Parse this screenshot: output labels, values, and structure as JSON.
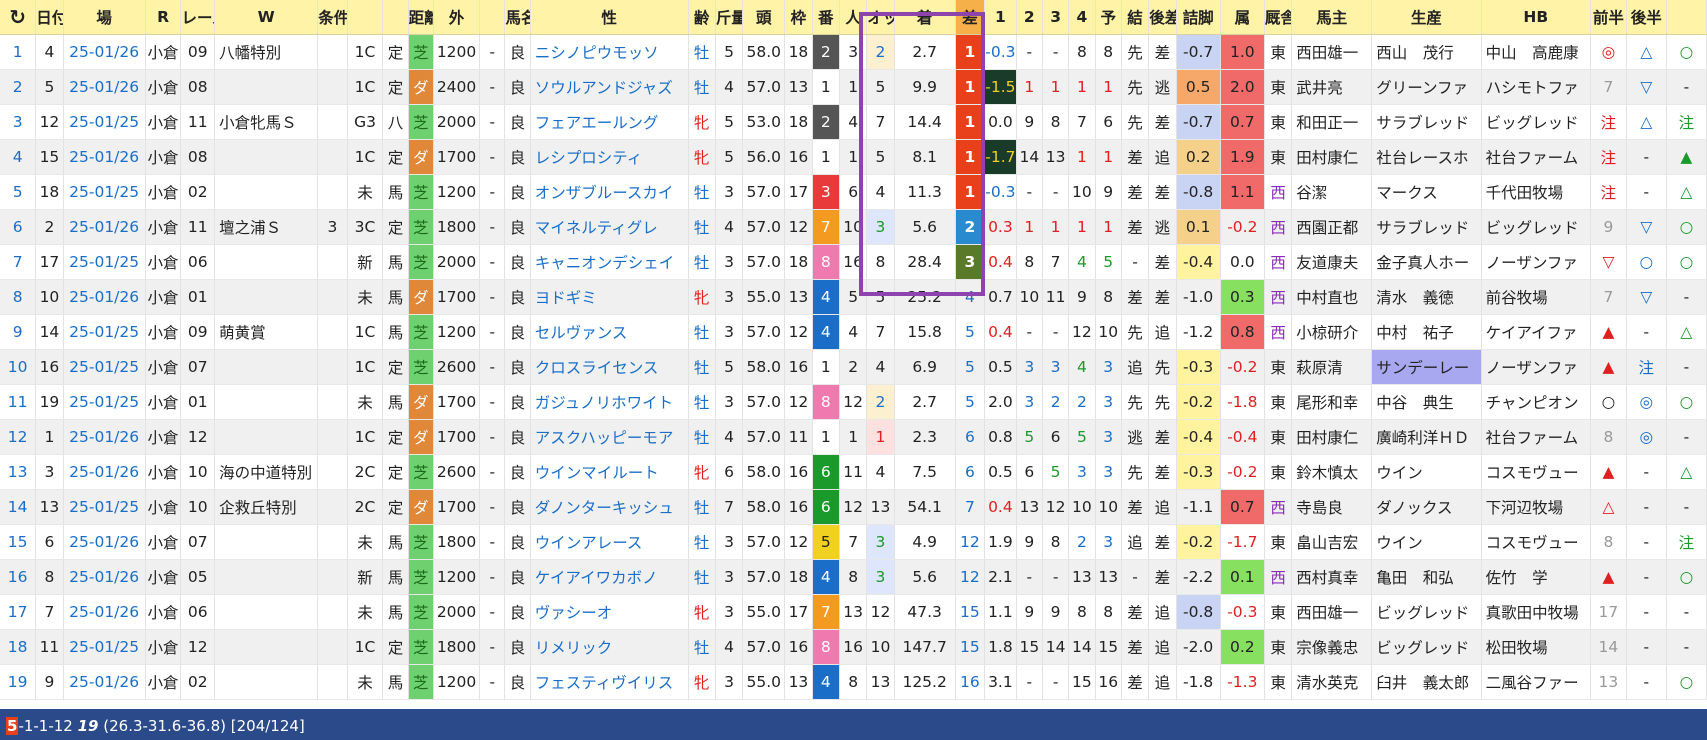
{
  "header": {
    "refresh_icon": "refresh-icon",
    "columns": [
      "",
      "日付",
      "場",
      "R",
      "レース名",
      "W",
      "条件",
      "",
      "",
      "距離",
      "外",
      "",
      "馬名",
      "性",
      "齢",
      "斤量",
      "頭",
      "枠",
      "番",
      "人",
      "オッズ",
      "着",
      "差",
      "1",
      "2",
      "3",
      "4",
      "予",
      "結",
      "後差",
      "詰脚",
      "属",
      "厩舎",
      "馬主",
      "生産",
      "HB",
      "前半",
      "後半"
    ]
  },
  "colors": {
    "waku": {
      "1": "#ffffff",
      "2": "#555555",
      "3": "#e83a3a",
      "4": "#1a6ec8",
      "5": "#f0d020",
      "6": "#1a9a2a",
      "7": "#f59a20",
      "8": "#f07ab0"
    },
    "turf": "#6fd06f",
    "dirt": "#e0883a",
    "finish1": "#e8401a",
    "finish2": "#2a8ad0",
    "finish3": "#5a7a2a",
    "highlight_box": "#8e44ad"
  },
  "rows": [
    {
      "no": "1",
      "x": "4",
      "date": "25-01/26",
      "place": "小倉",
      "r": "09",
      "race": "八幡特別",
      "w": "",
      "cls": "1C",
      "cond": "定",
      "surf": "芝",
      "dist": "1200",
      "out": "-",
      "track": "良",
      "horse": "ニシノピウモッソ",
      "sex": "牡",
      "age": "5",
      "wt": "58.0",
      "heads": "18",
      "waku": "2",
      "ban": "3",
      "pop": "2",
      "odds": "2.7",
      "fin": "1",
      "diff": "-0.3",
      "c1": "-",
      "c2": "-",
      "c3": "8",
      "c4": "8",
      "yo": "先",
      "res": "差",
      "kosa": "-0.7",
      "tsume": "1.0",
      "zoku": "東",
      "stable": "西田雄一",
      "owner": "西山　茂行",
      "breeder": "中山　高鹿康",
      "hb": "◎",
      "zen": "△",
      "kou": "○"
    },
    {
      "no": "2",
      "x": "5",
      "date": "25-01/26",
      "place": "小倉",
      "r": "08",
      "race": "",
      "w": "",
      "cls": "1C",
      "cond": "定",
      "surf": "ダ",
      "dist": "2400",
      "out": "-",
      "track": "良",
      "horse": "ソウルアンドジャズ",
      "sex": "牡",
      "age": "4",
      "wt": "57.0",
      "heads": "13",
      "waku": "1",
      "ban": "1",
      "pop": "5",
      "odds": "9.9",
      "fin": "1",
      "diff": "-1.5",
      "c1": "1",
      "c2": "1",
      "c3": "1",
      "c4": "1",
      "yo": "先",
      "res": "逃",
      "kosa": "0.5",
      "tsume": "2.0",
      "zoku": "東",
      "stable": "武井亮",
      "owner": "グリーンファ",
      "breeder": "ハシモトファ",
      "hb": "7",
      "zen": "▽",
      "kou": "-"
    },
    {
      "no": "3",
      "x": "12",
      "date": "25-01/25",
      "place": "小倉",
      "r": "11",
      "race": "小倉牝馬Ｓ",
      "w": "",
      "cls": "G3",
      "cond": "八",
      "surf": "芝",
      "dist": "2000",
      "out": "-",
      "track": "良",
      "horse": "フェアエールング",
      "sex": "牝",
      "age": "5",
      "wt": "53.0",
      "heads": "18",
      "waku": "2",
      "ban": "4",
      "pop": "7",
      "odds": "14.4",
      "fin": "1",
      "diff": "0.0",
      "c1": "9",
      "c2": "8",
      "c3": "7",
      "c4": "6",
      "yo": "先",
      "res": "差",
      "kosa": "-0.7",
      "tsume": "0.7",
      "zoku": "東",
      "stable": "和田正一",
      "owner": "サラブレッド",
      "breeder": "ビッグレッド",
      "hb": "注",
      "zen": "△",
      "kou": "注"
    },
    {
      "no": "4",
      "x": "15",
      "date": "25-01/26",
      "place": "小倉",
      "r": "08",
      "race": "",
      "w": "",
      "cls": "1C",
      "cond": "定",
      "surf": "ダ",
      "dist": "1700",
      "out": "-",
      "track": "良",
      "horse": "レシプロシティ",
      "sex": "牝",
      "age": "5",
      "wt": "56.0",
      "heads": "16",
      "waku": "1",
      "ban": "1",
      "pop": "5",
      "odds": "8.1",
      "fin": "1",
      "diff": "-1.7",
      "c1": "14",
      "c2": "13",
      "c3": "1",
      "c4": "1",
      "yo": "差",
      "res": "追",
      "kosa": "0.2",
      "tsume": "1.9",
      "zoku": "東",
      "stable": "田村康仁",
      "owner": "社台レースホ",
      "breeder": "社台ファーム",
      "hb": "注",
      "zen": "-",
      "kou": "▲"
    },
    {
      "no": "5",
      "x": "18",
      "date": "25-01/25",
      "place": "小倉",
      "r": "02",
      "race": "",
      "w": "",
      "cls": "未",
      "cond": "馬",
      "surf": "芝",
      "dist": "1200",
      "out": "-",
      "track": "良",
      "horse": "オンザブルースカイ",
      "sex": "牡",
      "age": "3",
      "wt": "57.0",
      "heads": "17",
      "waku": "3",
      "ban": "6",
      "pop": "4",
      "odds": "11.3",
      "fin": "1",
      "diff": "-0.3",
      "c1": "-",
      "c2": "-",
      "c3": "10",
      "c4": "9",
      "yo": "差",
      "res": "差",
      "kosa": "-0.8",
      "tsume": "1.1",
      "zoku": "西",
      "stable": "谷潔",
      "owner": "マークス",
      "breeder": "千代田牧場",
      "hb": "注",
      "zen": "-",
      "kou": "△"
    },
    {
      "no": "6",
      "x": "2",
      "date": "25-01/26",
      "place": "小倉",
      "r": "11",
      "race": "壇之浦Ｓ",
      "w": "3",
      "cls": "3C",
      "cond": "定",
      "surf": "芝",
      "dist": "1800",
      "out": "-",
      "track": "良",
      "horse": "マイネルティグレ",
      "sex": "牡",
      "age": "4",
      "wt": "57.0",
      "heads": "12",
      "waku": "7",
      "ban": "10",
      "pop": "3",
      "odds": "5.6",
      "fin": "2",
      "diff": "0.3",
      "c1": "1",
      "c2": "1",
      "c3": "1",
      "c4": "1",
      "yo": "差",
      "res": "逃",
      "kosa": "0.1",
      "tsume": "-0.2",
      "zoku": "西",
      "stable": "西園正都",
      "owner": "サラブレッド",
      "breeder": "ビッグレッド",
      "hb": "9",
      "zen": "▽",
      "kou": "○"
    },
    {
      "no": "7",
      "x": "17",
      "date": "25-01/25",
      "place": "小倉",
      "r": "06",
      "race": "",
      "w": "",
      "cls": "新",
      "cond": "馬",
      "surf": "芝",
      "dist": "2000",
      "out": "-",
      "track": "良",
      "horse": "キャニオンデシェイ",
      "sex": "牡",
      "age": "3",
      "wt": "57.0",
      "heads": "18",
      "waku": "8",
      "ban": "16",
      "pop": "8",
      "odds": "28.4",
      "fin": "3",
      "diff": "0.4",
      "c1": "8",
      "c2": "7",
      "c3": "4",
      "c4": "5",
      "yo": "-",
      "res": "差",
      "kosa": "-0.4",
      "tsume": "0.0",
      "zoku": "西",
      "stable": "友道康夫",
      "owner": "金子真人ホー",
      "breeder": "ノーザンファ",
      "hb": "▽",
      "zen": "○",
      "kou": "○"
    },
    {
      "no": "8",
      "x": "10",
      "date": "25-01/26",
      "place": "小倉",
      "r": "01",
      "race": "",
      "w": "",
      "cls": "未",
      "cond": "馬",
      "surf": "ダ",
      "dist": "1700",
      "out": "-",
      "track": "良",
      "horse": "ヨドギミ",
      "sex": "牝",
      "age": "3",
      "wt": "55.0",
      "heads": "13",
      "waku": "4",
      "ban": "5",
      "pop": "5",
      "odds": "25.2",
      "fin": "4",
      "diff": "0.7",
      "c1": "10",
      "c2": "11",
      "c3": "9",
      "c4": "8",
      "yo": "差",
      "res": "差",
      "kosa": "-1.0",
      "tsume": "0.3",
      "zoku": "西",
      "stable": "中村直也",
      "owner": "清水　義徳",
      "breeder": "前谷牧場",
      "hb": "7",
      "zen": "▽",
      "kou": "-"
    },
    {
      "no": "9",
      "x": "14",
      "date": "25-01/25",
      "place": "小倉",
      "r": "09",
      "race": "萌黄賞",
      "w": "",
      "cls": "1C",
      "cond": "馬",
      "surf": "芝",
      "dist": "1200",
      "out": "-",
      "track": "良",
      "horse": "セルヴァンス",
      "sex": "牡",
      "age": "3",
      "wt": "57.0",
      "heads": "12",
      "waku": "4",
      "ban": "4",
      "pop": "7",
      "odds": "15.8",
      "fin": "5",
      "diff": "0.4",
      "c1": "-",
      "c2": "-",
      "c3": "12",
      "c4": "10",
      "yo": "先",
      "res": "追",
      "kosa": "-1.2",
      "tsume": "0.8",
      "zoku": "西",
      "stable": "小椋研介",
      "owner": "中村　祐子",
      "breeder": "ケイアイファ",
      "hb": "▲",
      "zen": "-",
      "kou": "△"
    },
    {
      "no": "10",
      "x": "16",
      "date": "25-01/25",
      "place": "小倉",
      "r": "07",
      "race": "",
      "w": "",
      "cls": "1C",
      "cond": "定",
      "surf": "芝",
      "dist": "2600",
      "out": "-",
      "track": "良",
      "horse": "クロスライセンス",
      "sex": "牡",
      "age": "5",
      "wt": "58.0",
      "heads": "16",
      "waku": "1",
      "ban": "2",
      "pop": "4",
      "odds": "6.9",
      "fin": "5",
      "diff": "0.5",
      "c1": "3",
      "c2": "3",
      "c3": "4",
      "c4": "3",
      "yo": "追",
      "res": "先",
      "kosa": "-0.3",
      "tsume": "-0.2",
      "zoku": "東",
      "stable": "萩原清",
      "owner": "サンデーレー",
      "breeder": "ノーザンファ",
      "hb": "▲",
      "zen": "注",
      "kou": "-"
    },
    {
      "no": "11",
      "x": "19",
      "date": "25-01/25",
      "place": "小倉",
      "r": "01",
      "race": "",
      "w": "",
      "cls": "未",
      "cond": "馬",
      "surf": "ダ",
      "dist": "1700",
      "out": "-",
      "track": "良",
      "horse": "ガジュノリホワイト",
      "sex": "牡",
      "age": "3",
      "wt": "57.0",
      "heads": "12",
      "waku": "8",
      "ban": "12",
      "pop": "2",
      "odds": "2.7",
      "fin": "5",
      "diff": "2.0",
      "c1": "3",
      "c2": "2",
      "c3": "2",
      "c4": "3",
      "yo": "先",
      "res": "先",
      "kosa": "-0.2",
      "tsume": "-1.8",
      "zoku": "東",
      "stable": "尾形和幸",
      "owner": "中谷　典生",
      "breeder": "チャンピオン",
      "hb": "○",
      "zen": "◎",
      "kou": "○"
    },
    {
      "no": "12",
      "x": "1",
      "date": "25-01/26",
      "place": "小倉",
      "r": "12",
      "race": "",
      "w": "",
      "cls": "1C",
      "cond": "定",
      "surf": "ダ",
      "dist": "1700",
      "out": "-",
      "track": "良",
      "horse": "アスクハッピーモア",
      "sex": "牡",
      "age": "4",
      "wt": "57.0",
      "heads": "11",
      "waku": "1",
      "ban": "1",
      "pop": "1",
      "odds": "2.3",
      "fin": "6",
      "diff": "0.8",
      "c1": "5",
      "c2": "6",
      "c3": "5",
      "c4": "3",
      "yo": "逃",
      "res": "差",
      "kosa": "-0.4",
      "tsume": "-0.4",
      "zoku": "東",
      "stable": "田村康仁",
      "owner": "廣崎利洋ＨＤ",
      "breeder": "社台ファーム",
      "hb": "8",
      "zen": "◎",
      "kou": "-"
    },
    {
      "no": "13",
      "x": "3",
      "date": "25-01/26",
      "place": "小倉",
      "r": "10",
      "race": "海の中道特別",
      "w": "",
      "cls": "2C",
      "cond": "定",
      "surf": "芝",
      "dist": "2600",
      "out": "-",
      "track": "良",
      "horse": "ウインマイルート",
      "sex": "牝",
      "age": "6",
      "wt": "58.0",
      "heads": "16",
      "waku": "6",
      "ban": "11",
      "pop": "4",
      "odds": "7.5",
      "fin": "6",
      "diff": "0.5",
      "c1": "6",
      "c2": "5",
      "c3": "3",
      "c4": "3",
      "yo": "先",
      "res": "差",
      "kosa": "-0.3",
      "tsume": "-0.2",
      "zoku": "東",
      "stable": "鈴木慎太",
      "owner": "ウイン",
      "breeder": "コスモヴュー",
      "hb": "▲",
      "zen": "-",
      "kou": "△"
    },
    {
      "no": "14",
      "x": "13",
      "date": "25-01/25",
      "place": "小倉",
      "r": "10",
      "race": "企救丘特別",
      "w": "",
      "cls": "2C",
      "cond": "定",
      "surf": "ダ",
      "dist": "1700",
      "out": "-",
      "track": "良",
      "horse": "ダノンターキッシュ",
      "sex": "牡",
      "age": "7",
      "wt": "58.0",
      "heads": "16",
      "waku": "6",
      "ban": "12",
      "pop": "13",
      "odds": "54.1",
      "fin": "7",
      "diff": "0.4",
      "c1": "13",
      "c2": "12",
      "c3": "10",
      "c4": "10",
      "yo": "差",
      "res": "追",
      "kosa": "-1.1",
      "tsume": "0.7",
      "zoku": "西",
      "stable": "寺島良",
      "owner": "ダノックス",
      "breeder": "下河辺牧場",
      "hb": "△",
      "zen": "-",
      "kou": "-"
    },
    {
      "no": "15",
      "x": "6",
      "date": "25-01/26",
      "place": "小倉",
      "r": "07",
      "race": "",
      "w": "",
      "cls": "未",
      "cond": "馬",
      "surf": "芝",
      "dist": "1800",
      "out": "-",
      "track": "良",
      "horse": "ウインアレース",
      "sex": "牡",
      "age": "3",
      "wt": "57.0",
      "heads": "12",
      "waku": "5",
      "ban": "7",
      "pop": "3",
      "odds": "4.9",
      "fin": "12",
      "diff": "1.9",
      "c1": "9",
      "c2": "8",
      "c3": "2",
      "c4": "3",
      "yo": "追",
      "res": "差",
      "kosa": "-0.2",
      "tsume": "-1.7",
      "zoku": "東",
      "stable": "畠山吉宏",
      "owner": "ウイン",
      "breeder": "コスモヴュー",
      "hb": "8",
      "zen": "-",
      "kou": "注"
    },
    {
      "no": "16",
      "x": "8",
      "date": "25-01/26",
      "place": "小倉",
      "r": "05",
      "race": "",
      "w": "",
      "cls": "新",
      "cond": "馬",
      "surf": "芝",
      "dist": "1200",
      "out": "-",
      "track": "良",
      "horse": "ケイアイワカボノ",
      "sex": "牡",
      "age": "3",
      "wt": "57.0",
      "heads": "18",
      "waku": "4",
      "ban": "8",
      "pop": "3",
      "odds": "5.6",
      "fin": "12",
      "diff": "2.1",
      "c1": "-",
      "c2": "-",
      "c3": "13",
      "c4": "13",
      "yo": "-",
      "res": "差",
      "kosa": "-2.2",
      "tsume": "0.1",
      "zoku": "西",
      "stable": "西村真幸",
      "owner": "亀田　和弘",
      "breeder": "佐竹　学",
      "hb": "▲",
      "zen": "-",
      "kou": "○"
    },
    {
      "no": "17",
      "x": "7",
      "date": "25-01/26",
      "place": "小倉",
      "r": "06",
      "race": "",
      "w": "",
      "cls": "未",
      "cond": "馬",
      "surf": "芝",
      "dist": "2000",
      "out": "-",
      "track": "良",
      "horse": "ヴァシーオ",
      "sex": "牝",
      "age": "3",
      "wt": "55.0",
      "heads": "17",
      "waku": "7",
      "ban": "13",
      "pop": "12",
      "odds": "47.3",
      "fin": "15",
      "diff": "1.1",
      "c1": "9",
      "c2": "9",
      "c3": "8",
      "c4": "8",
      "yo": "差",
      "res": "追",
      "kosa": "-0.8",
      "tsume": "-0.3",
      "zoku": "東",
      "stable": "西田雄一",
      "owner": "ビッグレッド",
      "breeder": "真歌田中牧場",
      "hb": "17",
      "zen": "-",
      "kou": "-"
    },
    {
      "no": "18",
      "x": "11",
      "date": "25-01/25",
      "place": "小倉",
      "r": "12",
      "race": "",
      "w": "",
      "cls": "1C",
      "cond": "定",
      "surf": "芝",
      "dist": "1800",
      "out": "-",
      "track": "良",
      "horse": "リメリック",
      "sex": "牡",
      "age": "4",
      "wt": "57.0",
      "heads": "16",
      "waku": "8",
      "ban": "16",
      "pop": "10",
      "odds": "147.7",
      "fin": "15",
      "diff": "1.8",
      "c1": "15",
      "c2": "14",
      "c3": "14",
      "c4": "15",
      "yo": "差",
      "res": "追",
      "kosa": "-2.0",
      "tsume": "0.2",
      "zoku": "東",
      "stable": "宗像義忠",
      "owner": "ビッグレッド",
      "breeder": "松田牧場",
      "hb": "14",
      "zen": "-",
      "kou": "-"
    },
    {
      "no": "19",
      "x": "9",
      "date": "25-01/26",
      "place": "小倉",
      "r": "02",
      "race": "",
      "w": "",
      "cls": "未",
      "cond": "馬",
      "surf": "芝",
      "dist": "1200",
      "out": "-",
      "track": "良",
      "horse": "フェスティヴイリス",
      "sex": "牝",
      "age": "3",
      "wt": "55.0",
      "heads": "13",
      "waku": "4",
      "ban": "8",
      "pop": "13",
      "odds": "125.2",
      "fin": "16",
      "diff": "3.1",
      "c1": "-",
      "c2": "-",
      "c3": "15",
      "c4": "16",
      "yo": "差",
      "res": "追",
      "kosa": "-1.8",
      "tsume": "-1.3",
      "zoku": "東",
      "stable": "清水英克",
      "owner": "臼井　義太郎",
      "breeder": "二風谷ファー",
      "hb": "13",
      "zen": "-",
      "kou": "○"
    }
  ],
  "footer": {
    "first": "5",
    "mid": "-1-1-12 ",
    "count": "19",
    "rest": " (26.3-31.6-36.8) [204/124]"
  }
}
